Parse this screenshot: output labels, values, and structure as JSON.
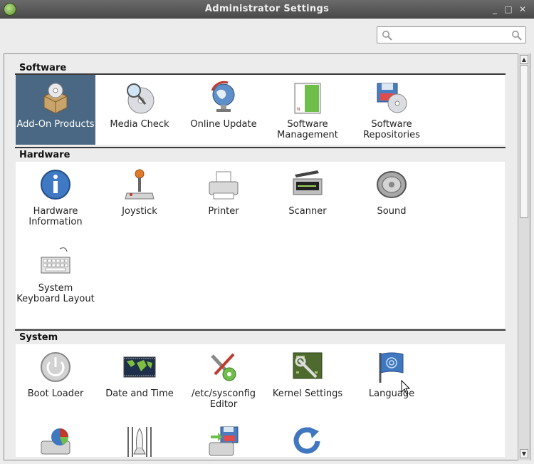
{
  "window": {
    "title": "Administrator Settings",
    "minimize_glyph": "_",
    "maximize_glyph": "□",
    "close_glyph": "✕"
  },
  "search": {
    "placeholder": ""
  },
  "sections": [
    {
      "title": "Software",
      "items": [
        {
          "label": "Add-On Products",
          "icon": "add-on-products-icon",
          "selected": true
        },
        {
          "label": "Media Check",
          "icon": "media-check-icon"
        },
        {
          "label": "Online Update",
          "icon": "online-update-icon"
        },
        {
          "label": "Software Management",
          "icon": "software-management-icon"
        },
        {
          "label": "Software Repositories",
          "icon": "software-repositories-icon"
        }
      ]
    },
    {
      "title": "Hardware",
      "items": [
        {
          "label": "Hardware Information",
          "icon": "hardware-information-icon"
        },
        {
          "label": "Joystick",
          "icon": "joystick-icon"
        },
        {
          "label": "Printer",
          "icon": "printer-icon"
        },
        {
          "label": "Scanner",
          "icon": "scanner-icon"
        },
        {
          "label": "Sound",
          "icon": "sound-icon"
        },
        {
          "label": "System Keyboard Layout",
          "icon": "keyboard-icon"
        }
      ]
    },
    {
      "title": "System",
      "items": [
        {
          "label": "Boot Loader",
          "icon": "boot-loader-icon"
        },
        {
          "label": "Date and Time",
          "icon": "date-time-icon"
        },
        {
          "label": "/etc/sysconfig Editor",
          "icon": "sysconfig-editor-icon"
        },
        {
          "label": "Kernel Settings",
          "icon": "kernel-settings-icon"
        },
        {
          "label": "Language",
          "icon": "language-icon"
        },
        {
          "label": "",
          "icon": "partitioner-icon"
        },
        {
          "label": "",
          "icon": "services-icon"
        },
        {
          "label": "",
          "icon": "system-backup-icon"
        },
        {
          "label": "",
          "icon": "restore-icon"
        }
      ]
    }
  ]
}
